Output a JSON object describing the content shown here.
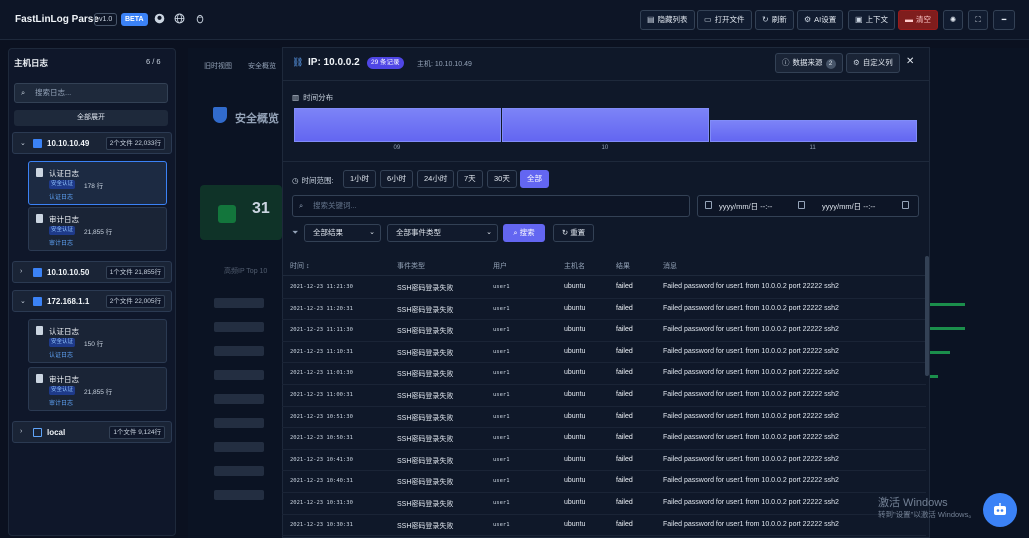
{
  "app": {
    "name": "FastLinLog Parse",
    "version": "v1.0",
    "badge": "BETA"
  },
  "header_icons": [
    "github-icon",
    "globe-icon",
    "linux-icon"
  ],
  "toolbar": {
    "hide_list": "隐藏列表",
    "open_file": "打开文件",
    "refresh": "刷新",
    "ai_settings": "AI设置",
    "context": "上下文",
    "clear": "清空"
  },
  "sidebar": {
    "title": "主机日志",
    "count": "6 / 6",
    "search_placeholder": "搜索日志...",
    "expand_all": "全部展开",
    "hosts": [
      {
        "name": "10.10.10.49",
        "meta": "2个文件 22,033行",
        "files": [
          {
            "name": "认证日志",
            "tag": "安全认证",
            "size": "178 行",
            "sub": "认证日志"
          },
          {
            "name": "审计日志",
            "tag": "安全认证",
            "size": "21,855 行",
            "sub": "审计日志"
          }
        ]
      },
      {
        "name": "10.10.10.50",
        "meta": "1个文件 21,855行",
        "files": []
      },
      {
        "name": "172.168.1.1",
        "meta": "2个文件 22,005行",
        "files": [
          {
            "name": "认证日志",
            "tag": "安全认证",
            "size": "150 行",
            "sub": "认证日志"
          },
          {
            "name": "审计日志",
            "tag": "安全认证",
            "size": "21,855 行",
            "sub": "审计日志"
          }
        ]
      },
      {
        "name": "local",
        "meta": "1个文件 9,124行",
        "files": []
      }
    ]
  },
  "background": {
    "tabs": [
      "旧时视图",
      "安全概览"
    ],
    "title": "安全概览",
    "big_number": "31",
    "top10_label": "高频IP Top 10"
  },
  "modal": {
    "title": "IP: 10.0.0.2",
    "badge": "29 条记录",
    "host": "主机: 10.10.10.49",
    "data_source": "数据来源",
    "data_source_count": "2",
    "custom_columns": "自定义列",
    "histogram_label": "时间分布",
    "histogram": [
      {
        "label": "09",
        "level": 1.0
      },
      {
        "label": "10",
        "level": 1.0
      },
      {
        "label": "11",
        "level": 0.65
      }
    ],
    "time_range_label": "时间范围:",
    "ranges": [
      "1小时",
      "6小时",
      "24小时",
      "7天",
      "30天",
      "全部"
    ],
    "active_range": "全部",
    "search_placeholder": "搜索关键词...",
    "date_from": "yyyy/mm/日 --:--",
    "date_to": "yyyy/mm/日 --:--",
    "result_filter": "全部结果",
    "event_filter": "全部事件类型",
    "search_btn": "搜索",
    "reset_btn": "重置",
    "columns": [
      "时间 ↕",
      "事件类型",
      "用户",
      "主机名",
      "结果",
      "消息"
    ],
    "rows": [
      {
        "time": "2021-12-23 11:21:30",
        "event": "SSH密码登录失败",
        "user": "user1",
        "host": "ubuntu",
        "result": "failed",
        "msg": "Failed password for user1 from 10.0.0.2 port 22222 ssh2"
      },
      {
        "time": "2021-12-23 11:20:31",
        "event": "SSH密码登录失败",
        "user": "user1",
        "host": "ubuntu",
        "result": "failed",
        "msg": "Failed password for user1 from 10.0.0.2 port 22222 ssh2"
      },
      {
        "time": "2021-12-23 11:11:30",
        "event": "SSH密码登录失败",
        "user": "user1",
        "host": "ubuntu",
        "result": "failed",
        "msg": "Failed password for user1 from 10.0.0.2 port 22222 ssh2"
      },
      {
        "time": "2021-12-23 11:10:31",
        "event": "SSH密码登录失败",
        "user": "user1",
        "host": "ubuntu",
        "result": "failed",
        "msg": "Failed password for user1 from 10.0.0.2 port 22222 ssh2"
      },
      {
        "time": "2021-12-23 11:01:30",
        "event": "SSH密码登录失败",
        "user": "user1",
        "host": "ubuntu",
        "result": "failed",
        "msg": "Failed password for user1 from 10.0.0.2 port 22222 ssh2"
      },
      {
        "time": "2021-12-23 11:00:31",
        "event": "SSH密码登录失败",
        "user": "user1",
        "host": "ubuntu",
        "result": "failed",
        "msg": "Failed password for user1 from 10.0.0.2 port 22222 ssh2"
      },
      {
        "time": "2021-12-23 10:51:30",
        "event": "SSH密码登录失败",
        "user": "user1",
        "host": "ubuntu",
        "result": "failed",
        "msg": "Failed password for user1 from 10.0.0.2 port 22222 ssh2"
      },
      {
        "time": "2021-12-23 10:50:31",
        "event": "SSH密码登录失败",
        "user": "user1",
        "host": "ubuntu",
        "result": "failed",
        "msg": "Failed password for user1 from 10.0.0.2 port 22222 ssh2"
      },
      {
        "time": "2021-12-23 10:41:30",
        "event": "SSH密码登录失败",
        "user": "user1",
        "host": "ubuntu",
        "result": "failed",
        "msg": "Failed password for user1 from 10.0.0.2 port 22222 ssh2"
      },
      {
        "time": "2021-12-23 10:40:31",
        "event": "SSH密码登录失败",
        "user": "user1",
        "host": "ubuntu",
        "result": "failed",
        "msg": "Failed password for user1 from 10.0.0.2 port 22222 ssh2"
      },
      {
        "time": "2021-12-23 10:31:30",
        "event": "SSH密码登录失败",
        "user": "user1",
        "host": "ubuntu",
        "result": "failed",
        "msg": "Failed password for user1 from 10.0.0.2 port 22222 ssh2"
      },
      {
        "time": "2021-12-23 10:30:31",
        "event": "SSH密码登录失败",
        "user": "user1",
        "host": "ubuntu",
        "result": "failed",
        "msg": "Failed password for user1 from 10.0.0.2 port 22222 ssh2"
      }
    ]
  },
  "watermark": {
    "line1": "激活 Windows",
    "line2": "转到\"设置\"以激活 Windows。"
  },
  "colors": {
    "accent": "#6366f1",
    "primary": "#3b82f6",
    "danger": "#7f1d1d",
    "bg": "#0b1120"
  }
}
